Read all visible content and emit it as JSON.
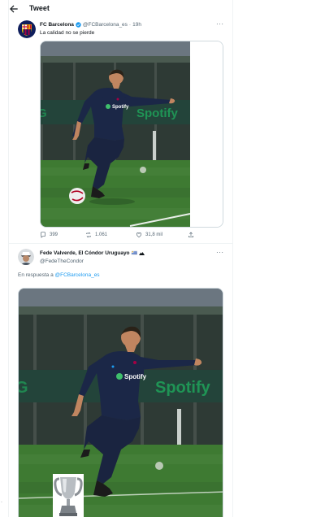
{
  "header": {
    "title": "Tweet"
  },
  "tweet": {
    "author_name": "FC Barcelona",
    "author_handle": "@FCBarcelona_es",
    "separator": "·",
    "time": "19h",
    "text": "La calidad no se pierde",
    "actions": {
      "replies": "399",
      "retweets": "1.061",
      "likes": "31,8 mil"
    }
  },
  "reply": {
    "author_name": "Fede Valverde, El Cóndor Uruguayo",
    "author_handle": "@FedeTheCondor",
    "replying_prefix": "En respuesta a",
    "replying_to": "@FCBarcelona_es",
    "flag_emoji": "🇺🇾"
  },
  "photo": {
    "shirt_sponsor": "Spotify",
    "wall_sponsor": "Spotify"
  },
  "colors": {
    "accent": "#1d9bf0",
    "barca_blue": "#0f1e5c",
    "barca_red": "#a50044",
    "grass": "#3e7a32"
  },
  "icons": [
    "back-arrow-icon",
    "verified-badge-icon",
    "more-icon",
    "reply-icon",
    "retweet-icon",
    "like-icon",
    "share-icon",
    "trophy-icon"
  ]
}
